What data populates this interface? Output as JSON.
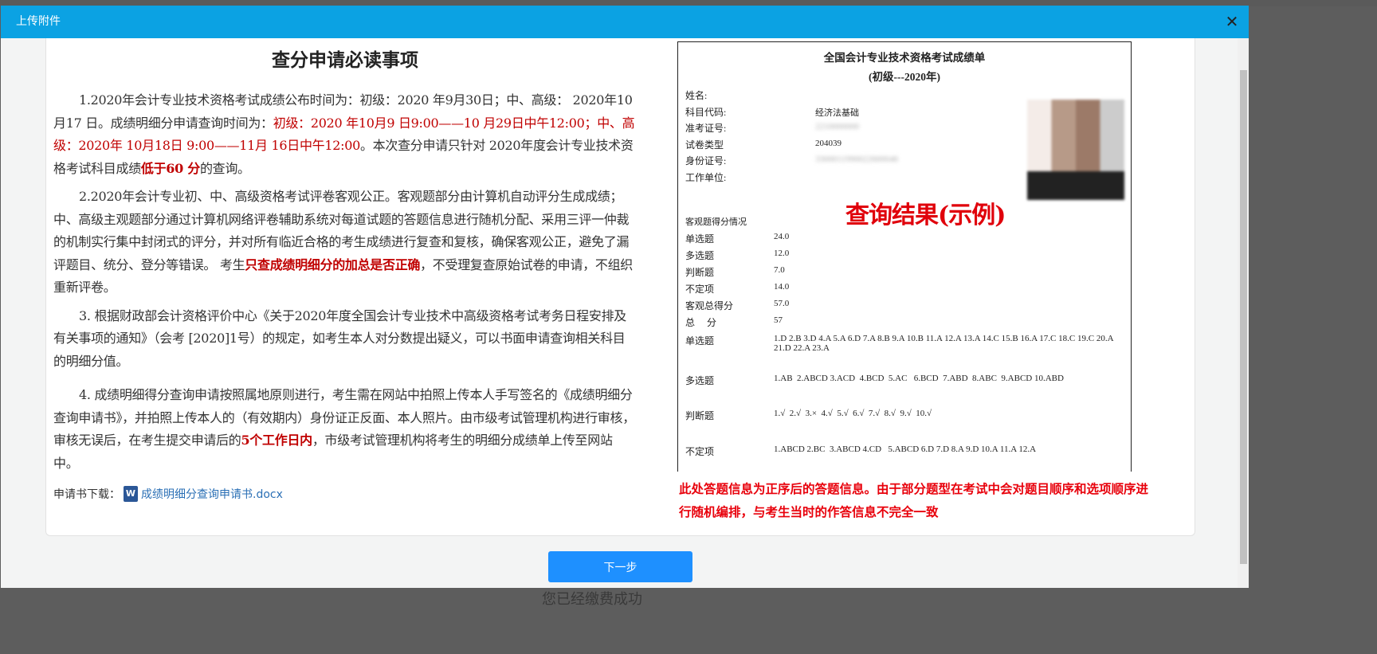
{
  "modal": {
    "title": "上传附件",
    "close": "✕",
    "next_label": "下一步"
  },
  "notice": {
    "title": "查分申请必读事项",
    "paragraphs": [
      [
        {
          "t": "1.2020年会计专业技术资格考试成绩公布时间为：初级：2020 年9月30日；中、高级： 2020年10月17 日。成绩明细分申请查询时间为：",
          "s": ""
        },
        {
          "t": "初级：2020 年10月9 日9:00——10 月29日中午12:00；中、高级：2020年 10月18日 9:00——11月 16日中午12:00",
          "s": "red"
        },
        {
          "t": "。本次查分申请只针对 2020年度会计专业技术资格考试科目成绩",
          "s": ""
        },
        {
          "t": "低于60 分",
          "s": "redb"
        },
        {
          "t": "的查询。",
          "s": ""
        }
      ],
      [
        {
          "t": "2.2020年会计专业初、中、高级资格考试评卷客观公正。客观题部分由计算机自动评分生成成绩；中、高级主观题部分通过计算机网络评卷辅助系统对每道试题的答题信息进行随机分配、采用三评一仲裁的机制实行集中封闭式的评分，并对所有临近合格的考生成绩进行复查和复核，确保客观公正，避免了漏评题目、统分、登分等错误。 考生",
          "s": ""
        },
        {
          "t": "只查成绩明细分的加总是否正确",
          "s": "redb"
        },
        {
          "t": "，不受理复查原始试卷的申请，不组织重新评卷。",
          "s": ""
        }
      ],
      [
        {
          "t": "3. 根据财政部会计资格评价中心《关于2020年度全国会计专业技术中高级资格考试考务日程安排及有关事项的通知》（会考 [2020]1号）的规定，如考生本人对分数提出疑义，可以书面申请查询相关科目的明细分值。",
          "s": ""
        }
      ],
      [
        {
          "t": "4. 成绩明细得分查询申请按照属地原则进行，考生需在网站中拍照上传本人手写签名的《成绩明细分查询申请书》，并拍照上传本人的（有效期内）身份证正反面、本人照片。由市级考试管理机构进行审核，审核无误后，在考生提交申请后的",
          "s": ""
        },
        {
          "t": "5个工作日内",
          "s": "redb"
        },
        {
          "t": "，市级考试管理机构将考生的明细分成绩单上传至网站中。",
          "s": ""
        }
      ]
    ],
    "download_label": "申请书下载：",
    "download_file": "成绩明细分查询申请书.docx"
  },
  "report": {
    "title": "全国会计专业技术资格考试成绩单",
    "subtitle": "(初级---2020年)",
    "fields": [
      {
        "label": "姓名:",
        "value": "",
        "blur": true
      },
      {
        "label": "科目代码:",
        "value": "经济法基础",
        "blur": false
      },
      {
        "label": "准考证号:",
        "value": "2210000000",
        "blur": true
      },
      {
        "label": "试卷类型",
        "value": "204039",
        "blur": false
      },
      {
        "label": "身份证号:",
        "value": "3300011990022600046",
        "blur": true
      },
      {
        "label": "工作单位:",
        "value": "",
        "blur": false
      }
    ],
    "stamp": "查询结果(示例)",
    "objective_header": "客观题得分情况",
    "scores": [
      {
        "label": "单选题",
        "value": "24.0"
      },
      {
        "label": "多选题",
        "value": "12.0"
      },
      {
        "label": "判断题",
        "value": "7.0"
      },
      {
        "label": "不定项",
        "value": "14.0"
      },
      {
        "label": "客观总得分",
        "value": "57.0"
      },
      {
        "label": "总　 分",
        "value": "57"
      }
    ],
    "answers": [
      {
        "label": "单选题",
        "value": "1.D 2.B 3.D 4.A 5.A 6.D 7.A 8.B 9.A 10.B 11.A 12.A 13.A 14.C 15.B 16.A 17.C 18.C 19.C 20.A 21.D 22.A 23.A"
      },
      {
        "label": "多选题",
        "value": "1.AB  2.ABCD 3.ACD  4.BCD  5.AC   6.BCD  7.ABD  8.ABC  9.ABCD 10.ABD"
      },
      {
        "label": "判断题",
        "value": "1.√  2.√  3.×  4.√  5.√  6.√  7.√  8.√  9.√  10.√"
      },
      {
        "label": "不定项",
        "value": "1.ABCD 2.BC  3.ABCD 4.CD   5.ABCD 6.D 7.D 8.A 9.D 10.A 11.A 12.A"
      }
    ]
  },
  "note": "此处答题信息为正序后的答题信息。由于部分题型在考试中会对题目顺序和选项顺序进行随机编排，与考生当时的作答信息不完全一致",
  "background_text": "您已经缴费成功"
}
